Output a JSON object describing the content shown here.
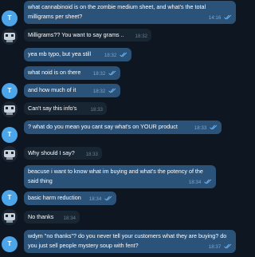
{
  "avatars": {
    "user_initial": "T",
    "other_icon": "bot-avatar-icon"
  },
  "colors": {
    "background": "#0e1621",
    "outgoing_bubble": "#2b5278",
    "incoming_bubble": "#182533",
    "user_avatar": "#4ca5e8",
    "read_ticks": "#6ab3f3"
  },
  "messages": [
    {
      "direction": "out",
      "text": "what cannabinoid is on the zombie medium sheet, and what's the total milligrams per sheet?",
      "time": "14:16",
      "read": true
    },
    {
      "direction": "in",
      "text": "Milligrams?? You want to say grams ..",
      "time": "18:32"
    },
    {
      "direction": "out",
      "text": "yea mb typo, but yea still",
      "time": "18:32",
      "read": true
    },
    {
      "direction": "out",
      "text": "what noid is on there",
      "time": "18:32",
      "read": true
    },
    {
      "direction": "out",
      "text": "and how much of it",
      "time": "18:32",
      "read": true
    },
    {
      "direction": "in",
      "text": "Can't say this info's",
      "time": "18:33"
    },
    {
      "direction": "out",
      "text": "? what do you mean you cant say what's on YOUR product",
      "time": "18:33",
      "read": true
    },
    {
      "direction": "in",
      "text": "Why should I say?",
      "time": "18:33"
    },
    {
      "direction": "out",
      "text": "beacuse i want to know what im buying and what's the potency of the said thing",
      "time": "18:34",
      "read": true
    },
    {
      "direction": "out",
      "text": "basic harm reduction",
      "time": "18:34",
      "read": true
    },
    {
      "direction": "in",
      "text": "No thanks",
      "time": "18:34"
    },
    {
      "direction": "out",
      "text": "wdym \"no thanks\"? do you never tell your customers what they are buying? do you just sell people mystery soup with fent?",
      "time": "18:37",
      "read": true
    }
  ]
}
